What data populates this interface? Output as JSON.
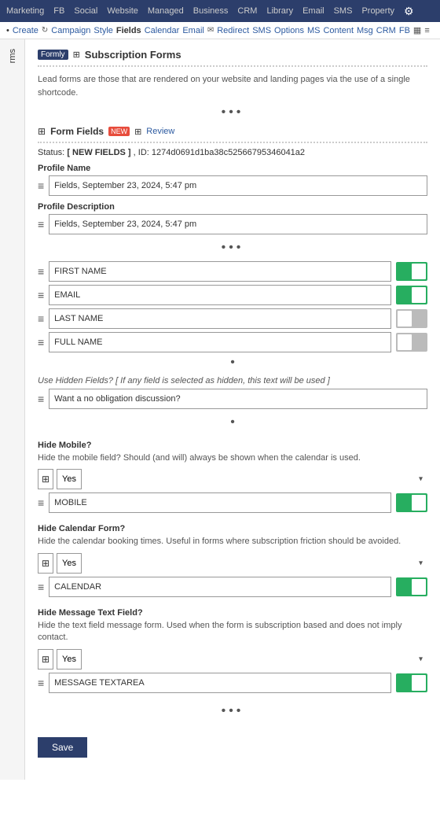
{
  "topNav": {
    "items": [
      "Marketing",
      "FB",
      "Social",
      "Website",
      "Managed",
      "Business",
      "CRM",
      "Library",
      "Email",
      "SMS",
      "Property"
    ],
    "gearLabel": "⚙"
  },
  "subNav": {
    "bullet": "•",
    "items": [
      {
        "label": "Create",
        "active": false
      },
      {
        "label": "Campaign",
        "active": false
      },
      {
        "label": "Style",
        "active": false
      },
      {
        "label": "Fields",
        "active": true
      },
      {
        "label": "Calendar",
        "active": false
      },
      {
        "label": "Email",
        "active": false
      },
      {
        "label": "Redirect",
        "active": false
      },
      {
        "label": "SMS",
        "active": false
      },
      {
        "label": "Options",
        "active": false
      },
      {
        "label": "MS",
        "active": false
      },
      {
        "label": "Content",
        "active": false
      },
      {
        "label": "Msg",
        "active": false
      },
      {
        "label": "CRM",
        "active": false
      },
      {
        "label": "FB",
        "active": false
      }
    ]
  },
  "sidebar": {
    "label": "rms"
  },
  "sectionHeader": {
    "formlyLabel": "Formly",
    "subscriptionLabel": "Subscription Forms"
  },
  "descriptionText": "Lead forms are those that are rendered on your website and landing pages via the use of a single shortcode.",
  "formFieldsSection": {
    "title": "Form Fields",
    "newBadge": "NEW",
    "reviewLabel": "Review"
  },
  "statusRow": {
    "prefix": "Status:",
    "statusValue": "[ NEW FIELDS ]",
    "idPrefix": ", ID:",
    "idValue": "1274d0691d1ba38c52566795346041a2"
  },
  "profileName": {
    "label": "Profile Name",
    "value": "Fields, September 23, 2024, 5:47 pm"
  },
  "profileDescription": {
    "label": "Profile Description",
    "value": "Fields, September 23, 2024, 5:47 pm"
  },
  "formFields": [
    {
      "name": "FIRST NAME",
      "enabled": true
    },
    {
      "name": "EMAIL",
      "enabled": true
    },
    {
      "name": "LAST NAME",
      "enabled": false
    },
    {
      "name": "FULL NAME",
      "enabled": false
    }
  ],
  "hiddenField": {
    "labelMain": "Use Hidden Fields?",
    "labelNote": "[ If any field is selected as hidden, this text will be used ]",
    "value": "Want a no obligation discussion?"
  },
  "hideMobile": {
    "title": "Hide Mobile?",
    "description": "Hide the mobile field? Should (and will) always be shown when the calendar is used.",
    "selectValue": "Yes",
    "fieldName": "MOBILE",
    "enabled": true
  },
  "hideCalendar": {
    "title": "Hide Calendar Form?",
    "description": "Hide the calendar booking times. Useful in forms where subscription friction should be avoided.",
    "selectValue": "Yes",
    "fieldName": "CALENDAR",
    "enabled": true
  },
  "hideMessage": {
    "title": "Hide Message Text Field?",
    "description": "Hide the text field message form. Used when the form is subscription based and does not imply contact.",
    "selectValue": "Yes",
    "fieldName": "MESSAGE TEXTAREA",
    "enabled": true
  },
  "saveButton": "Save",
  "icons": {
    "drag": "≡",
    "plus": "⊞",
    "dots": "•••"
  }
}
